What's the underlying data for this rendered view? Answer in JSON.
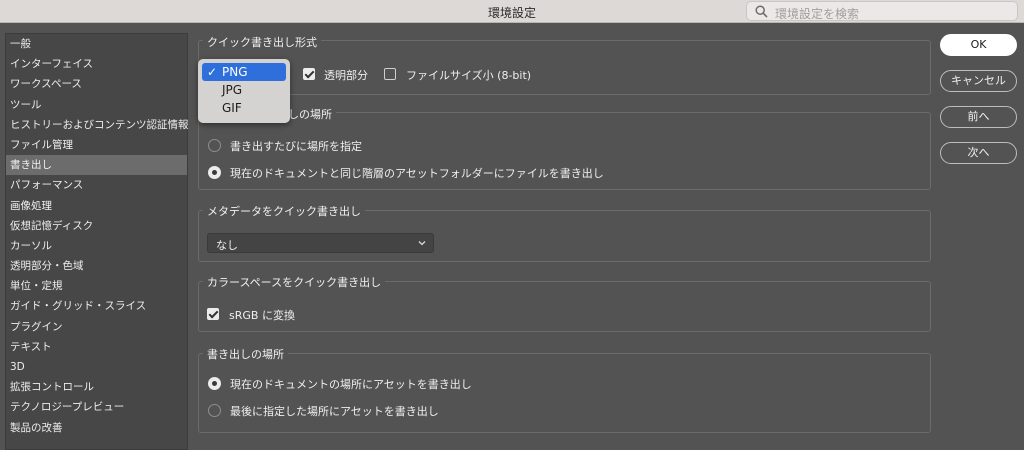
{
  "window": {
    "title": "環境設定"
  },
  "search": {
    "placeholder": "環境設定を検索",
    "icon": "search-icon"
  },
  "sidebar": {
    "selected_index": 7,
    "items": [
      {
        "label": "一般"
      },
      {
        "label": "インターフェイス"
      },
      {
        "label": "ワークスペース"
      },
      {
        "label": "ツール"
      },
      {
        "label": "ヒストリーおよびコンテンツ認証情報"
      },
      {
        "label": "ファイル管理"
      },
      {
        "label": "書き出し"
      },
      {
        "label": "パフォーマンス"
      },
      {
        "label": "画像処理"
      },
      {
        "label": "仮想記憶ディスク"
      },
      {
        "label": "カーソル"
      },
      {
        "label": "透明部分・色域"
      },
      {
        "label": "単位・定規"
      },
      {
        "label": "ガイド・グリッド・スライス"
      },
      {
        "label": "プラグイン"
      },
      {
        "label": "テキスト"
      },
      {
        "label": "3D"
      },
      {
        "label": "拡張コントロール"
      },
      {
        "label": "テクノロジープレビュー"
      },
      {
        "label": "製品の改善"
      }
    ]
  },
  "quick_export_format": {
    "title": "クイック書き出し形式",
    "transparency_label": "透明部分",
    "transparency_checked": true,
    "small_file_label": "ファイルサイズ小 (8-bit)",
    "small_file_checked": false
  },
  "format_dropdown": {
    "options": [
      "PNG",
      "JPG",
      "GIF"
    ],
    "selected": "PNG",
    "checkmark": "✓"
  },
  "quick_export_location": {
    "title_visible": "しの場所",
    "option1": "書き出すたびに場所を指定",
    "option2": "現在のドキュメントと同じ階層のアセットフォルダーにファイルを書き出し",
    "selected": 2
  },
  "metadata": {
    "title": "メタデータをクイック書き出し",
    "value": "なし"
  },
  "colorspace": {
    "title": "カラースペースをクイック書き出し",
    "srgb_label": "sRGB に変換",
    "srgb_checked": true
  },
  "export_location": {
    "title": "書き出しの場所",
    "option1": "現在のドキュメントの場所にアセットを書き出し",
    "option2": "最後に指定した場所にアセットを書き出し",
    "selected": 1
  },
  "buttons": {
    "ok": "OK",
    "cancel": "キャンセル",
    "prev": "前へ",
    "next": "次へ"
  }
}
